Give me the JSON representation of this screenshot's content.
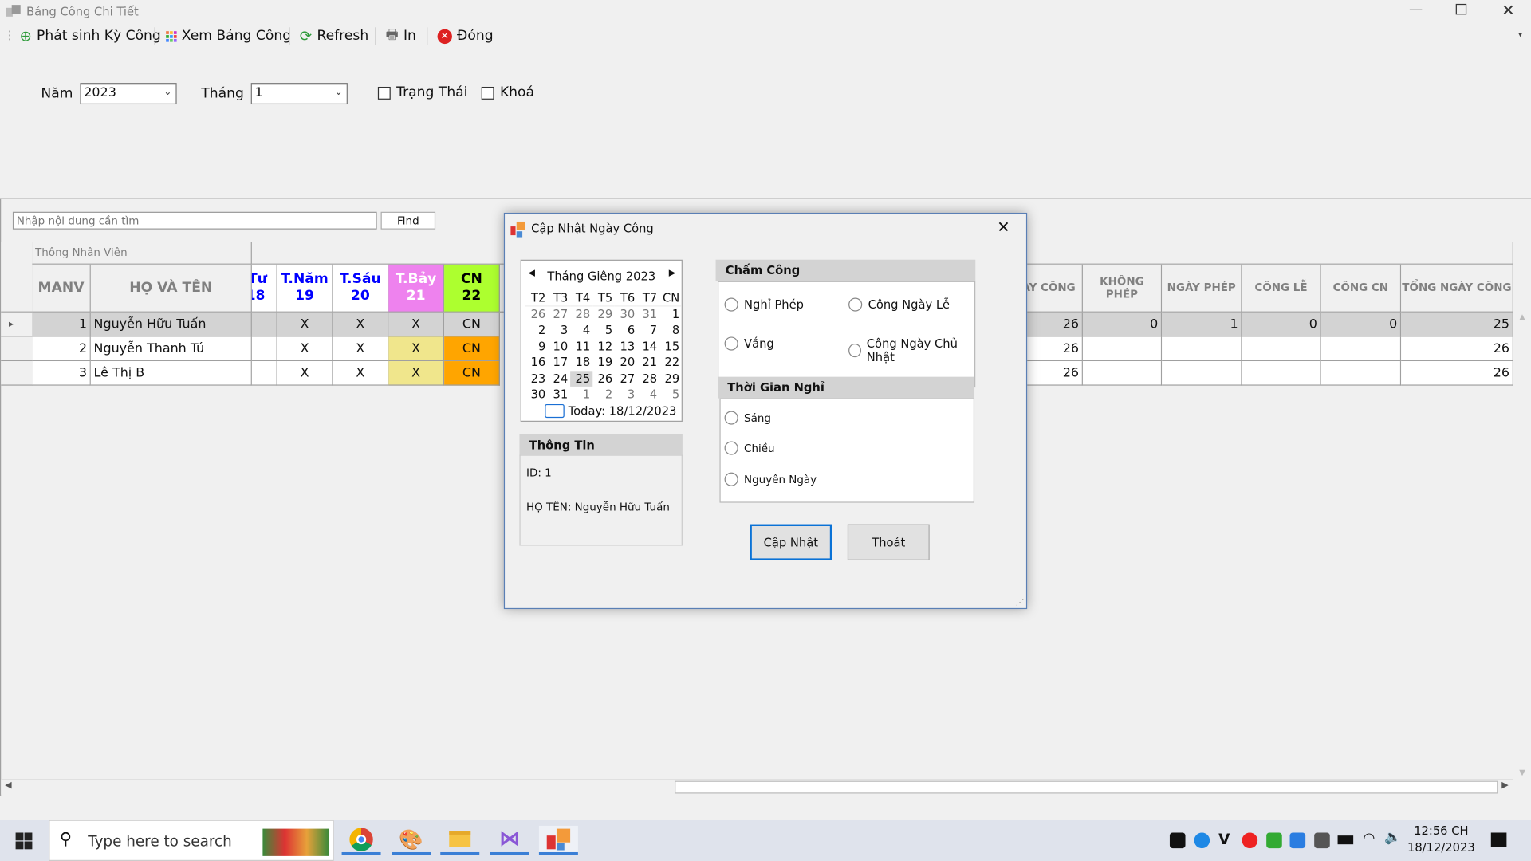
{
  "window": {
    "title": "Bảng Công Chi Tiết",
    "controls": [
      "minimize",
      "restore",
      "close"
    ]
  },
  "toolbar": {
    "items": [
      {
        "label": "Phát sinh Kỳ Công",
        "icon": "plus-circle-icon"
      },
      {
        "label": "Xem Bảng Công",
        "icon": "grid-icon"
      },
      {
        "label": "Refresh",
        "icon": "refresh-icon"
      },
      {
        "label": "In",
        "icon": "printer-icon"
      },
      {
        "label": "Đóng",
        "icon": "close-circle-icon"
      }
    ]
  },
  "filters": {
    "year_label": "Năm",
    "year_value": "2023",
    "month_label": "Tháng",
    "month_value": "1",
    "status_label": "Trạng Thái",
    "lock_label": "Khoá"
  },
  "search": {
    "placeholder": "Nhập nội dung cần tìm",
    "find_label": "Find"
  },
  "grid": {
    "group_header": "Thông Nhân Viên",
    "columns_left": [
      "MANV",
      "HỌ VÀ TÊN"
    ],
    "day_columns": [
      {
        "label": "Tư",
        "day": "18",
        "partial": true
      },
      {
        "label": "T.Năm",
        "day": "19"
      },
      {
        "label": "T.Sáu",
        "day": "20"
      },
      {
        "label": "T.Bảy",
        "day": "21"
      },
      {
        "label": "CN",
        "day": "22"
      }
    ],
    "columns_right": [
      "ÀY CÔNG",
      "KHÔNG PHÉP",
      "NGÀY PHÉP",
      "CÔNG LỄ",
      "CÔNG CN",
      "TỔNG NGÀY CÔNG"
    ],
    "rows": [
      {
        "manv": "1",
        "name": "Nguyễn Hữu Tuấn",
        "days": [
          "",
          "X",
          "X",
          "X",
          "CN"
        ],
        "right": [
          "26",
          "0",
          "1",
          "0",
          "0",
          "25"
        ],
        "selected": true
      },
      {
        "manv": "2",
        "name": "Nguyễn Thanh Tú",
        "days": [
          "",
          "X",
          "X",
          "X",
          "CN"
        ],
        "right": [
          "26",
          "",
          "",
          "",
          "",
          "26"
        ]
      },
      {
        "manv": "3",
        "name": "Lê Thị B",
        "days": [
          "",
          "X",
          "X",
          "X",
          "CN"
        ],
        "right": [
          "26",
          "",
          "",
          "",
          "",
          "26"
        ]
      }
    ],
    "colors": {
      "saturday_header": "#ee82ee",
      "sunday_header": "#adff2f",
      "saturday_cell": "#f0e68c",
      "sunday_cell": "#ffa500",
      "selected_row": "#d3d3d3"
    }
  },
  "dialog": {
    "title": "Cập Nhật Ngày Công",
    "calendar": {
      "month_title": "Tháng Giêng 2023",
      "weekdays": [
        "T2",
        "T3",
        "T4",
        "T5",
        "T6",
        "T7",
        "CN"
      ],
      "weeks": [
        [
          "26",
          "27",
          "28",
          "29",
          "30",
          "31",
          "1"
        ],
        [
          "2",
          "3",
          "4",
          "5",
          "6",
          "7",
          "8"
        ],
        [
          "9",
          "10",
          "11",
          "12",
          "13",
          "14",
          "15"
        ],
        [
          "16",
          "17",
          "18",
          "19",
          "20",
          "21",
          "22"
        ],
        [
          "23",
          "24",
          "25",
          "26",
          "27",
          "28",
          "29"
        ],
        [
          "30",
          "31",
          "1",
          "2",
          "3",
          "4",
          "5"
        ]
      ],
      "selected": "25",
      "today": "Today: 18/12/2023"
    },
    "info": {
      "title": "Thông Tin",
      "id": "ID: 1",
      "name": "HỌ TÊN: Nguyễn Hữu Tuấn"
    },
    "cham_cong": {
      "title": "Chấm Công",
      "options": [
        "Nghỉ Phép",
        "Công Ngày Lễ",
        "Vắng",
        "Công Ngày Chủ Nhật"
      ]
    },
    "thoi_gian": {
      "title": "Thời Gian Nghỉ",
      "options": [
        "Sáng",
        "Chiều",
        "Nguyên Ngày"
      ]
    },
    "update_label": "Cập Nhật",
    "exit_label": "Thoát"
  },
  "taskbar": {
    "search_placeholder": "Type here to search",
    "apps": [
      "chrome",
      "paint",
      "file-explorer",
      "visual-studio",
      "app"
    ],
    "time": "12:56 CH",
    "date": "18/12/2023",
    "tray": [
      "garena",
      "bluetooth",
      "vpn",
      "riot",
      "nvidia",
      "zalo",
      "keyboard",
      "battery",
      "wifi",
      "volume"
    ]
  }
}
